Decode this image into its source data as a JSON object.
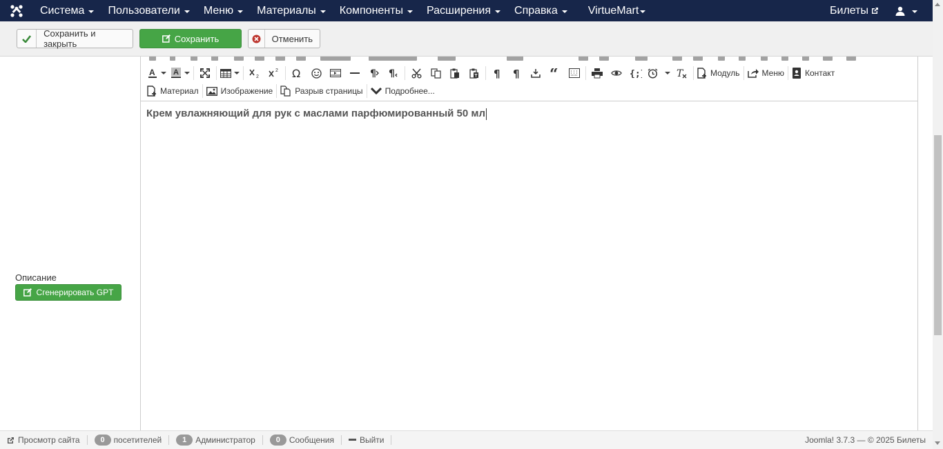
{
  "nav": {
    "items": [
      {
        "label": "Система",
        "name": "nav-system"
      },
      {
        "label": "Пользователи",
        "name": "nav-users"
      },
      {
        "label": "Меню",
        "name": "nav-menu"
      },
      {
        "label": "Материалы",
        "name": "nav-content"
      },
      {
        "label": "Компоненты",
        "name": "nav-components"
      },
      {
        "label": "Расширения",
        "name": "nav-extensions"
      },
      {
        "label": "Справка",
        "name": "nav-help"
      },
      {
        "label": "VirtueMart",
        "name": "nav-virtuemart"
      }
    ],
    "site_link": "Билеты"
  },
  "toolbar": {
    "save_close": "Сохранить и закрыть",
    "save": "Сохранить",
    "cancel": "Отменить"
  },
  "form": {
    "description_label": "Описание",
    "gpt_button": "Сгенерировать GPT"
  },
  "editor": {
    "buttons": {
      "module": "Модуль",
      "menu": "Меню",
      "contact": "Контакт",
      "article": "Материал",
      "image": "Изображение",
      "pagebreak": "Разрыв страницы",
      "readmore": "Подробнее..."
    },
    "content": "Крем увлажняющий для рук с маслами парфюмированный 50 мл"
  },
  "status": {
    "view_site": "Просмотр сайта",
    "visitors_count": "0",
    "visitors_label": "посетителей",
    "admins_count": "1",
    "admins_label": "Администратор",
    "messages_count": "0",
    "messages_label": "Сообщения",
    "logout": "Выйти",
    "footer": "Joomla! 3.7.3  —  © 2025 Билеты"
  },
  "colors": {
    "navbar": "#17264a",
    "success": "#46a546",
    "danger": "#bd362f"
  }
}
